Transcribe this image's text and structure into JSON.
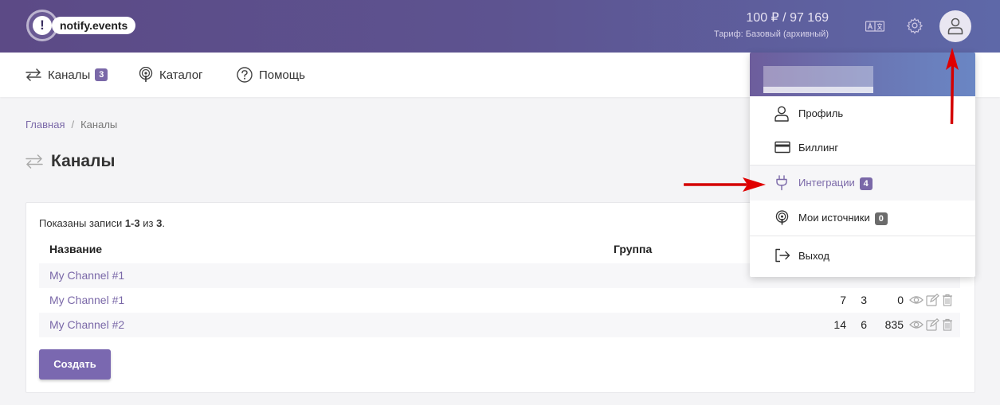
{
  "header": {
    "logo_text": "notify.events",
    "logo_mark": "!",
    "balance": "100 ₽ / 97 169",
    "tariff": "Тариф: Базовый (архивный)"
  },
  "nav": {
    "channels": {
      "label": "Каналы",
      "count": "3"
    },
    "catalog": {
      "label": "Каталог"
    },
    "help": {
      "label": "Помощь"
    }
  },
  "breadcrumb": {
    "home": "Главная",
    "separator": "/",
    "current": "Каналы"
  },
  "page_title": "Каналы",
  "table": {
    "summary_prefix": "Показаны записи ",
    "summary_range": "1-3",
    "summary_mid": " из ",
    "summary_total": "3",
    "summary_suffix": ".",
    "headers": {
      "name": "Название",
      "group": "Группа"
    },
    "rows": [
      {
        "name": "My Channel #1",
        "c1": "",
        "c2": "",
        "c3": ""
      },
      {
        "name": "My Channel #1",
        "c1": "7",
        "c2": "3",
        "c3": "0"
      },
      {
        "name": "My Channel #2",
        "c1": "14",
        "c2": "6",
        "c3": "835"
      }
    ],
    "create_label": "Создать"
  },
  "user_menu": {
    "items": [
      {
        "label": "Профиль",
        "icon": "user-icon"
      },
      {
        "label": "Биллинг",
        "icon": "credit-card-icon"
      },
      {
        "label": "Интеграции",
        "icon": "plug-icon",
        "count": "4"
      },
      {
        "label": "Мои источники",
        "icon": "podcast-icon",
        "count": "0"
      },
      {
        "label": "Выход",
        "icon": "logout-icon"
      }
    ]
  },
  "colors": {
    "accent": "#7a68a8",
    "header_start": "#5c4a86",
    "header_end": "#5e68a8",
    "annotation_arrow": "#e00000"
  }
}
